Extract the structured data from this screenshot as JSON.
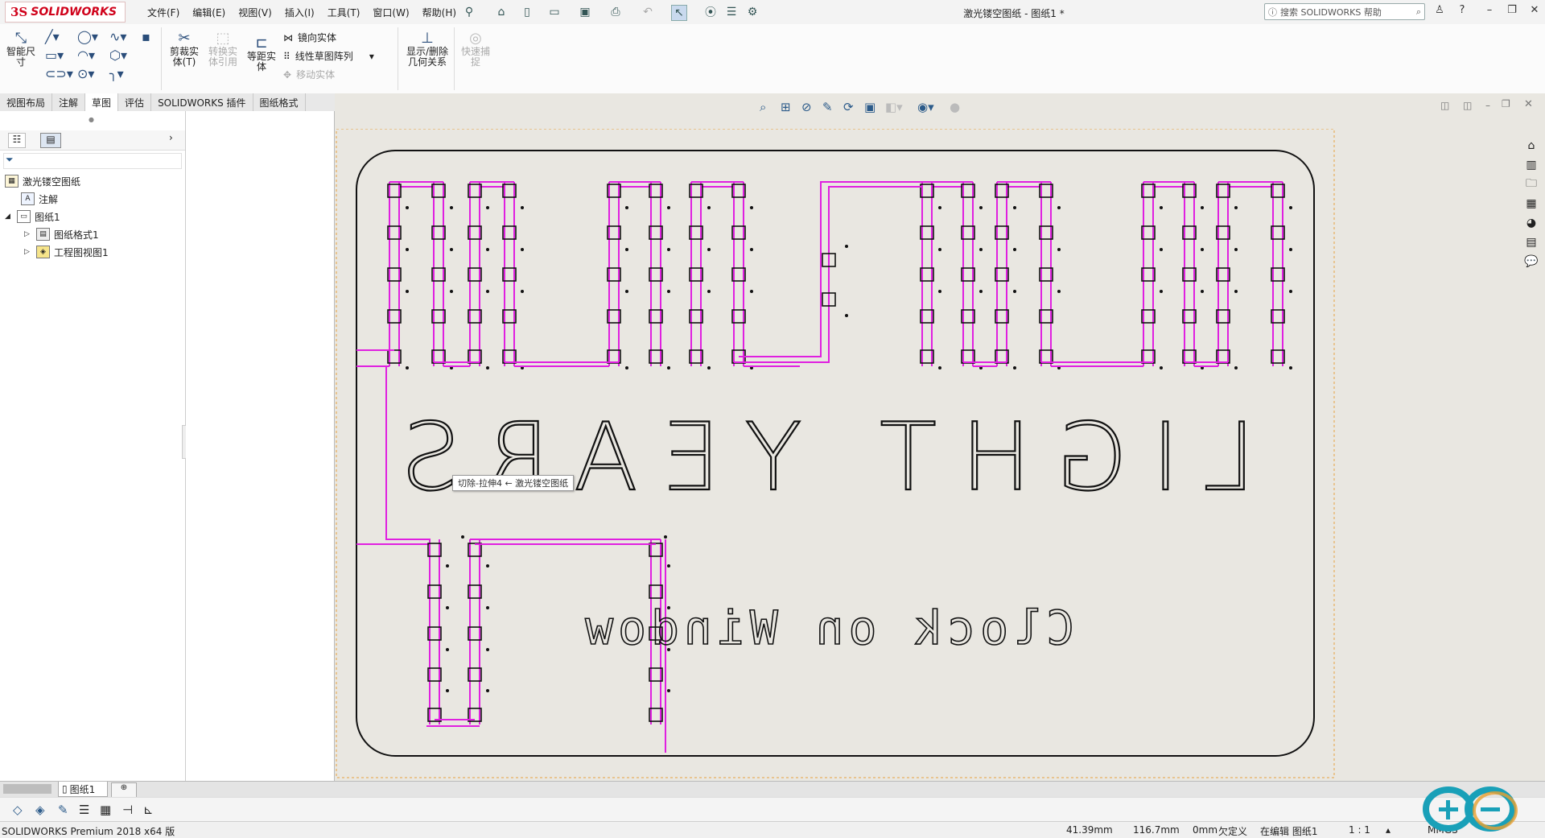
{
  "app": {
    "brand": "SOLIDWORKS",
    "doc_title": "激光镂空图纸 - 图纸1 *"
  },
  "menu": [
    "文件(F)",
    "编辑(E)",
    "视图(V)",
    "插入(I)",
    "工具(T)",
    "窗口(W)",
    "帮助(H)"
  ],
  "search": {
    "placeholder": "搜索 SOLIDWORKS 帮助"
  },
  "toolbar": {
    "smart_dim": "智能尺\n寸",
    "trim": "剪裁实\n体(T)",
    "convert": "转换实\n体引用",
    "offset": "等距实\n体",
    "mirror": "镜向实体",
    "linear_pattern": "线性草图阵列",
    "move": "移动实体",
    "relations": "显示/删除\n几何关系",
    "quick_snap": "快速捕\n捉"
  },
  "tabs": [
    "视图布局",
    "注解",
    "草图",
    "评估",
    "SOLIDWORKS 插件",
    "图纸格式"
  ],
  "active_tab": "草图",
  "tree": {
    "root": "激光镂空图纸",
    "annotations": "注解",
    "sheet": "图纸1",
    "sheet_format": "图纸格式1",
    "drawing_view": "工程图视图1"
  },
  "drawing": {
    "big_text": "LIGHT YEARS",
    "small_text": "Clock on Window"
  },
  "tooltip": "切除-拉伸4 ← 激光镂空图纸",
  "sheet_tab": "图纸1",
  "status": {
    "product": "SOLIDWORKS Premium 2018 x64 版",
    "x": "41.39mm",
    "y": "116.7mm",
    "z": "0mm",
    "definition": "欠定义",
    "editing": "在编辑 图纸1",
    "scale": "1 : 1",
    "units": "MMGS"
  },
  "colors": {
    "accent": "#d0021b",
    "sketch_magenta": "#e020e0",
    "sheet_bg": "#e9e7e1",
    "outline": "#111111"
  }
}
